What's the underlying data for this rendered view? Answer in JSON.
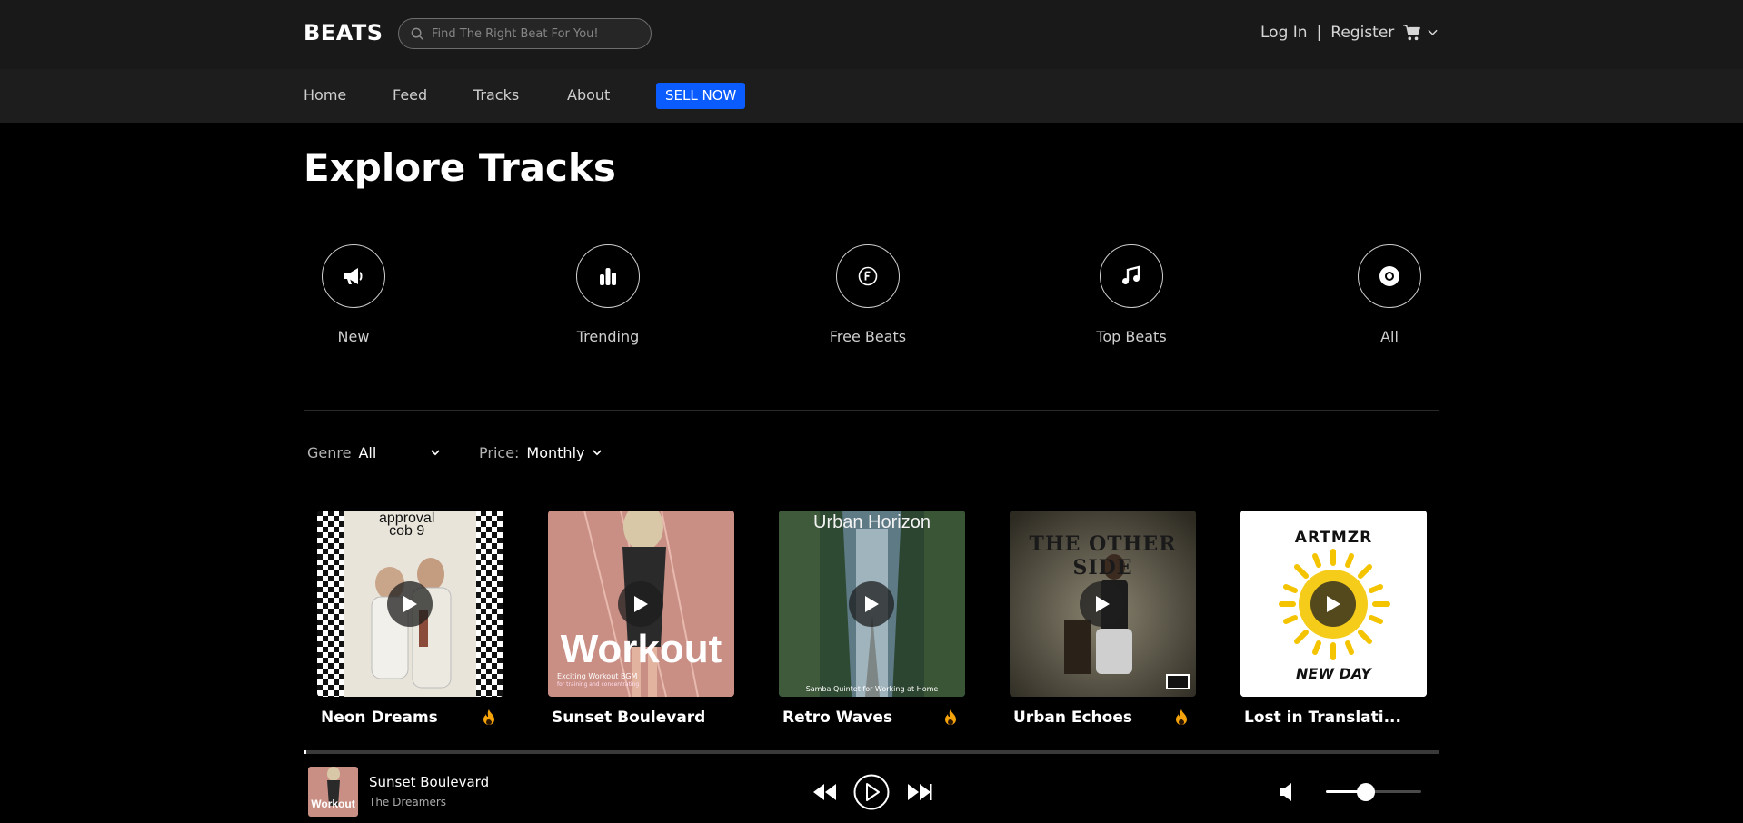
{
  "header": {
    "brand": "BEATS",
    "search_placeholder": "Find The Right Beat For You!",
    "login": "Log In",
    "separator": "|",
    "register": "Register"
  },
  "nav": {
    "home": "Home",
    "feed": "Feed",
    "tracks": "Tracks",
    "about": "About",
    "sell": "SELL NOW"
  },
  "page_title": "Explore Tracks",
  "categories": [
    {
      "label": "New",
      "icon": "megaphone-icon"
    },
    {
      "label": "Trending",
      "icon": "bar-chart-icon"
    },
    {
      "label": "Free Beats",
      "icon": "free-circle-icon"
    },
    {
      "label": "Top Beats",
      "icon": "music-note-icon"
    },
    {
      "label": "All",
      "icon": "vinyl-disc-icon"
    }
  ],
  "filters": {
    "genre_label": "Genre",
    "genre_value": "All",
    "price_label": "Price:",
    "price_value": "Monthly"
  },
  "tracks": [
    {
      "title": "Neon Dreams",
      "hot": true,
      "cover_text": [
        "approval",
        "cob 9"
      ]
    },
    {
      "title": "Sunset Boulevard",
      "hot": false,
      "cover_text": [
        "Workout",
        "Exciting Workout BGM",
        "for training and concentrating"
      ]
    },
    {
      "title": "Retro Waves",
      "hot": true,
      "cover_text": [
        "Urban Horizon",
        "Samba Quintet for Working at Home"
      ]
    },
    {
      "title": "Urban Echoes",
      "hot": true,
      "cover_text": [
        "THE OTHER SIDE"
      ]
    },
    {
      "title": "Lost in Translati...",
      "hot": false,
      "cover_text": [
        "ARTMZR",
        "NEW DAY"
      ]
    }
  ],
  "player": {
    "title": "Sunset Boulevard",
    "artist": "The Dreamers",
    "thumb_text": "Workout",
    "progress": 0.002,
    "volume": 0.42
  },
  "colors": {
    "accent": "#0a5cff",
    "fire": "#f5a30a",
    "topbar": "#191919",
    "navbar": "#1d1d1d"
  }
}
